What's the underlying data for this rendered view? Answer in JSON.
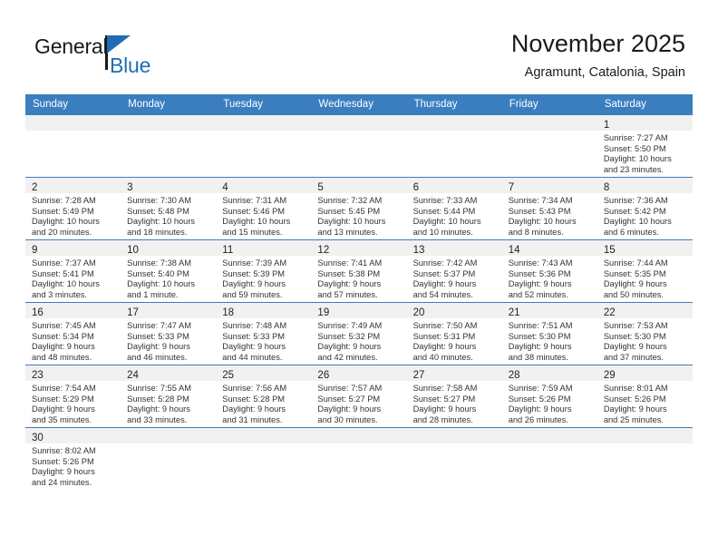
{
  "brand": {
    "name_part1": "General",
    "name_part2": "Blue",
    "accent_color": "#1f6eb5"
  },
  "header": {
    "title": "November 2025",
    "subtitle": "Agramunt, Catalonia, Spain",
    "header_bg_color": "#3a7ebf"
  },
  "calendar": {
    "weekday_headers": [
      "Sunday",
      "Monday",
      "Tuesday",
      "Wednesday",
      "Thursday",
      "Friday",
      "Saturday"
    ],
    "weeks": [
      [
        {
          "day": "",
          "sunrise": "",
          "sunset": "",
          "daylight_line1": "",
          "daylight_line2": ""
        },
        {
          "day": "",
          "sunrise": "",
          "sunset": "",
          "daylight_line1": "",
          "daylight_line2": ""
        },
        {
          "day": "",
          "sunrise": "",
          "sunset": "",
          "daylight_line1": "",
          "daylight_line2": ""
        },
        {
          "day": "",
          "sunrise": "",
          "sunset": "",
          "daylight_line1": "",
          "daylight_line2": ""
        },
        {
          "day": "",
          "sunrise": "",
          "sunset": "",
          "daylight_line1": "",
          "daylight_line2": ""
        },
        {
          "day": "",
          "sunrise": "",
          "sunset": "",
          "daylight_line1": "",
          "daylight_line2": ""
        },
        {
          "day": "1",
          "sunrise": "Sunrise: 7:27 AM",
          "sunset": "Sunset: 5:50 PM",
          "daylight_line1": "Daylight: 10 hours",
          "daylight_line2": "and 23 minutes."
        }
      ],
      [
        {
          "day": "2",
          "sunrise": "Sunrise: 7:28 AM",
          "sunset": "Sunset: 5:49 PM",
          "daylight_line1": "Daylight: 10 hours",
          "daylight_line2": "and 20 minutes."
        },
        {
          "day": "3",
          "sunrise": "Sunrise: 7:30 AM",
          "sunset": "Sunset: 5:48 PM",
          "daylight_line1": "Daylight: 10 hours",
          "daylight_line2": "and 18 minutes."
        },
        {
          "day": "4",
          "sunrise": "Sunrise: 7:31 AM",
          "sunset": "Sunset: 5:46 PM",
          "daylight_line1": "Daylight: 10 hours",
          "daylight_line2": "and 15 minutes."
        },
        {
          "day": "5",
          "sunrise": "Sunrise: 7:32 AM",
          "sunset": "Sunset: 5:45 PM",
          "daylight_line1": "Daylight: 10 hours",
          "daylight_line2": "and 13 minutes."
        },
        {
          "day": "6",
          "sunrise": "Sunrise: 7:33 AM",
          "sunset": "Sunset: 5:44 PM",
          "daylight_line1": "Daylight: 10 hours",
          "daylight_line2": "and 10 minutes."
        },
        {
          "day": "7",
          "sunrise": "Sunrise: 7:34 AM",
          "sunset": "Sunset: 5:43 PM",
          "daylight_line1": "Daylight: 10 hours",
          "daylight_line2": "and 8 minutes."
        },
        {
          "day": "8",
          "sunrise": "Sunrise: 7:36 AM",
          "sunset": "Sunset: 5:42 PM",
          "daylight_line1": "Daylight: 10 hours",
          "daylight_line2": "and 6 minutes."
        }
      ],
      [
        {
          "day": "9",
          "sunrise": "Sunrise: 7:37 AM",
          "sunset": "Sunset: 5:41 PM",
          "daylight_line1": "Daylight: 10 hours",
          "daylight_line2": "and 3 minutes."
        },
        {
          "day": "10",
          "sunrise": "Sunrise: 7:38 AM",
          "sunset": "Sunset: 5:40 PM",
          "daylight_line1": "Daylight: 10 hours",
          "daylight_line2": "and 1 minute."
        },
        {
          "day": "11",
          "sunrise": "Sunrise: 7:39 AM",
          "sunset": "Sunset: 5:39 PM",
          "daylight_line1": "Daylight: 9 hours",
          "daylight_line2": "and 59 minutes."
        },
        {
          "day": "12",
          "sunrise": "Sunrise: 7:41 AM",
          "sunset": "Sunset: 5:38 PM",
          "daylight_line1": "Daylight: 9 hours",
          "daylight_line2": "and 57 minutes."
        },
        {
          "day": "13",
          "sunrise": "Sunrise: 7:42 AM",
          "sunset": "Sunset: 5:37 PM",
          "daylight_line1": "Daylight: 9 hours",
          "daylight_line2": "and 54 minutes."
        },
        {
          "day": "14",
          "sunrise": "Sunrise: 7:43 AM",
          "sunset": "Sunset: 5:36 PM",
          "daylight_line1": "Daylight: 9 hours",
          "daylight_line2": "and 52 minutes."
        },
        {
          "day": "15",
          "sunrise": "Sunrise: 7:44 AM",
          "sunset": "Sunset: 5:35 PM",
          "daylight_line1": "Daylight: 9 hours",
          "daylight_line2": "and 50 minutes."
        }
      ],
      [
        {
          "day": "16",
          "sunrise": "Sunrise: 7:45 AM",
          "sunset": "Sunset: 5:34 PM",
          "daylight_line1": "Daylight: 9 hours",
          "daylight_line2": "and 48 minutes."
        },
        {
          "day": "17",
          "sunrise": "Sunrise: 7:47 AM",
          "sunset": "Sunset: 5:33 PM",
          "daylight_line1": "Daylight: 9 hours",
          "daylight_line2": "and 46 minutes."
        },
        {
          "day": "18",
          "sunrise": "Sunrise: 7:48 AM",
          "sunset": "Sunset: 5:33 PM",
          "daylight_line1": "Daylight: 9 hours",
          "daylight_line2": "and 44 minutes."
        },
        {
          "day": "19",
          "sunrise": "Sunrise: 7:49 AM",
          "sunset": "Sunset: 5:32 PM",
          "daylight_line1": "Daylight: 9 hours",
          "daylight_line2": "and 42 minutes."
        },
        {
          "day": "20",
          "sunrise": "Sunrise: 7:50 AM",
          "sunset": "Sunset: 5:31 PM",
          "daylight_line1": "Daylight: 9 hours",
          "daylight_line2": "and 40 minutes."
        },
        {
          "day": "21",
          "sunrise": "Sunrise: 7:51 AM",
          "sunset": "Sunset: 5:30 PM",
          "daylight_line1": "Daylight: 9 hours",
          "daylight_line2": "and 38 minutes."
        },
        {
          "day": "22",
          "sunrise": "Sunrise: 7:53 AM",
          "sunset": "Sunset: 5:30 PM",
          "daylight_line1": "Daylight: 9 hours",
          "daylight_line2": "and 37 minutes."
        }
      ],
      [
        {
          "day": "23",
          "sunrise": "Sunrise: 7:54 AM",
          "sunset": "Sunset: 5:29 PM",
          "daylight_line1": "Daylight: 9 hours",
          "daylight_line2": "and 35 minutes."
        },
        {
          "day": "24",
          "sunrise": "Sunrise: 7:55 AM",
          "sunset": "Sunset: 5:28 PM",
          "daylight_line1": "Daylight: 9 hours",
          "daylight_line2": "and 33 minutes."
        },
        {
          "day": "25",
          "sunrise": "Sunrise: 7:56 AM",
          "sunset": "Sunset: 5:28 PM",
          "daylight_line1": "Daylight: 9 hours",
          "daylight_line2": "and 31 minutes."
        },
        {
          "day": "26",
          "sunrise": "Sunrise: 7:57 AM",
          "sunset": "Sunset: 5:27 PM",
          "daylight_line1": "Daylight: 9 hours",
          "daylight_line2": "and 30 minutes."
        },
        {
          "day": "27",
          "sunrise": "Sunrise: 7:58 AM",
          "sunset": "Sunset: 5:27 PM",
          "daylight_line1": "Daylight: 9 hours",
          "daylight_line2": "and 28 minutes."
        },
        {
          "day": "28",
          "sunrise": "Sunrise: 7:59 AM",
          "sunset": "Sunset: 5:26 PM",
          "daylight_line1": "Daylight: 9 hours",
          "daylight_line2": "and 26 minutes."
        },
        {
          "day": "29",
          "sunrise": "Sunrise: 8:01 AM",
          "sunset": "Sunset: 5:26 PM",
          "daylight_line1": "Daylight: 9 hours",
          "daylight_line2": "and 25 minutes."
        }
      ],
      [
        {
          "day": "30",
          "sunrise": "Sunrise: 8:02 AM",
          "sunset": "Sunset: 5:26 PM",
          "daylight_line1": "Daylight: 9 hours",
          "daylight_line2": "and 24 minutes."
        },
        {
          "day": "",
          "sunrise": "",
          "sunset": "",
          "daylight_line1": "",
          "daylight_line2": ""
        },
        {
          "day": "",
          "sunrise": "",
          "sunset": "",
          "daylight_line1": "",
          "daylight_line2": ""
        },
        {
          "day": "",
          "sunrise": "",
          "sunset": "",
          "daylight_line1": "",
          "daylight_line2": ""
        },
        {
          "day": "",
          "sunrise": "",
          "sunset": "",
          "daylight_line1": "",
          "daylight_line2": ""
        },
        {
          "day": "",
          "sunrise": "",
          "sunset": "",
          "daylight_line1": "",
          "daylight_line2": ""
        },
        {
          "day": "",
          "sunrise": "",
          "sunset": "",
          "daylight_line1": "",
          "daylight_line2": ""
        }
      ]
    ]
  }
}
